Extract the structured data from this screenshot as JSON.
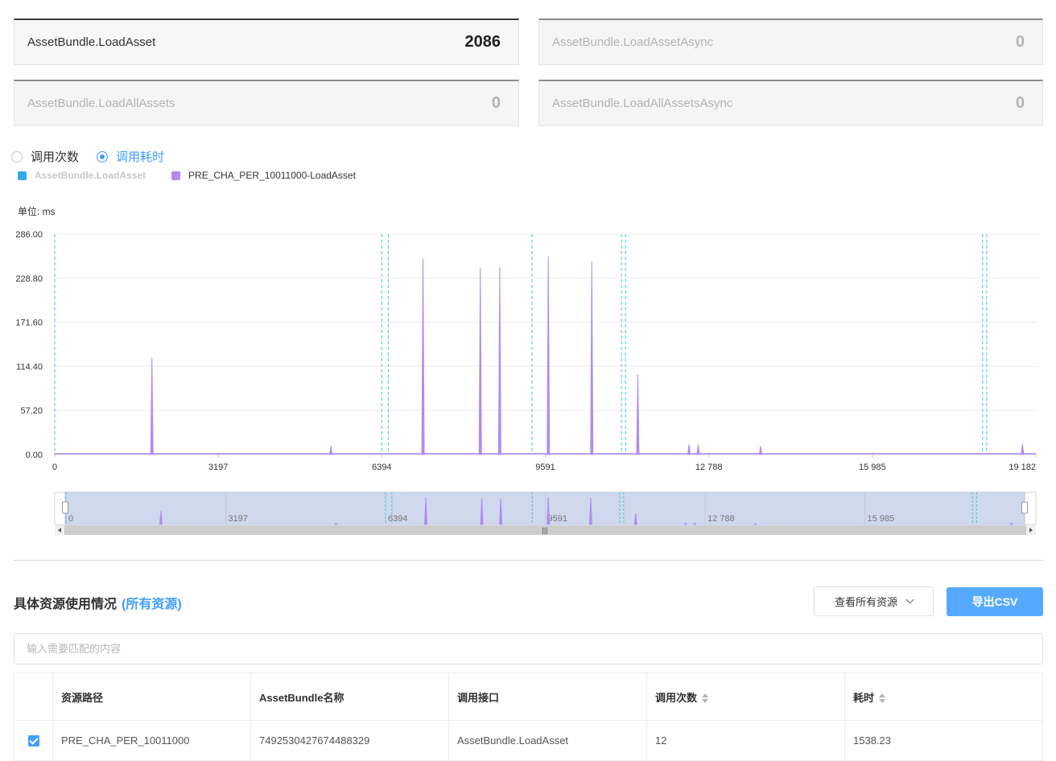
{
  "cards": [
    {
      "name": "AssetBundle.LoadAsset",
      "value": "2086",
      "active": true
    },
    {
      "name": "AssetBundle.LoadAssetAsync",
      "value": "0",
      "active": false
    },
    {
      "name": "AssetBundle.LoadAllAssets",
      "value": "0",
      "active": false
    },
    {
      "name": "AssetBundle.LoadAllAssetsAsync",
      "value": "0",
      "active": false
    }
  ],
  "radios": {
    "count_label": "调用次数",
    "time_label": "调用耗时",
    "selected": "time"
  },
  "legend": [
    {
      "name": "AssetBundle.LoadAsset",
      "color": "#35a9f0",
      "disabled": true
    },
    {
      "name": "PRE_CHA_PER_10011000-LoadAsset",
      "color": "#b18cf0",
      "disabled": false
    }
  ],
  "unit_label": "单位: ms",
  "chart_data": {
    "type": "line",
    "ylabel": "",
    "ylim": [
      0,
      286
    ],
    "yticks": [
      "0.00",
      "57.20",
      "114.40",
      "171.60",
      "228.80",
      "286.00"
    ],
    "xlim": [
      0,
      19182
    ],
    "xticks": [
      "0",
      "3197",
      "6394",
      "9591",
      "12 788",
      "15 985",
      "19 182"
    ],
    "series": [
      {
        "name": "PRE_CHA_PER_10011000-LoadAsset",
        "color": "#b18cf0",
        "spikes": [
          [
            1900,
            126
          ],
          [
            5400,
            11
          ],
          [
            7200,
            254
          ],
          [
            8320,
            242
          ],
          [
            8700,
            243
          ],
          [
            9650,
            257
          ],
          [
            10500,
            250
          ],
          [
            11400,
            104
          ],
          [
            12400,
            13
          ],
          [
            12580,
            13
          ],
          [
            13800,
            11
          ],
          [
            18920,
            14
          ]
        ]
      }
    ],
    "markers": [
      0,
      6394,
      6520,
      9330,
      11080,
      11160,
      18140,
      18220
    ],
    "marker_color": "#3fc7d8",
    "grid": true
  },
  "zoom": {
    "labels": [
      "0",
      "3197",
      "6394",
      "9591",
      "12 788",
      "15 985"
    ]
  },
  "section": {
    "title": "具体资源使用情况",
    "link": "(所有资源)"
  },
  "select_label": "查看所有资源",
  "export_label": "导出CSV",
  "search_placeholder": "输入需要匹配的内容",
  "table": {
    "headers": [
      "资源路径",
      "AssetBundle名称",
      "调用接口",
      "调用次数",
      "耗时"
    ],
    "rows": [
      [
        "PRE_CHA_PER_10011000",
        "7492530427674488329",
        "AssetBundle.LoadAsset",
        "12",
        "1538.23"
      ]
    ]
  }
}
